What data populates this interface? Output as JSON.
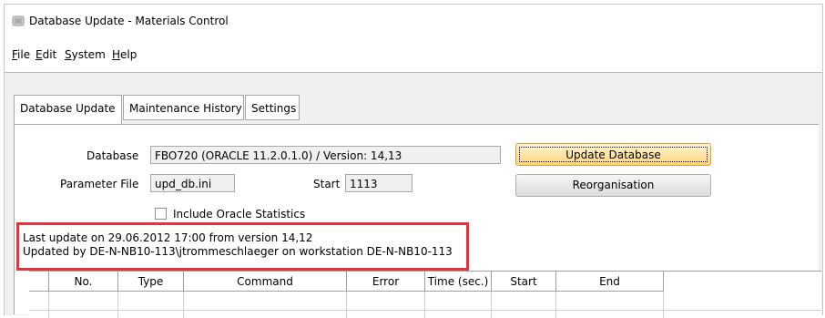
{
  "window": {
    "title": "Database Update - Materials Control"
  },
  "menu": [
    {
      "pre": "",
      "acc": "F",
      "post": "ile"
    },
    {
      "pre": "",
      "acc": "E",
      "post": "dit"
    },
    {
      "pre": "",
      "acc": "S",
      "post": "ystem"
    },
    {
      "pre": "",
      "acc": "H",
      "post": "elp"
    }
  ],
  "tabs": [
    "Database Update",
    "Maintenance History",
    "Settings"
  ],
  "form": {
    "database_label": "Database",
    "database_value": "FBO720 (ORACLE 11.2.0.1.0) / Version: 14,13",
    "parameter_label": "Parameter File",
    "parameter_value": "upd_db.ini",
    "start_label": "Start",
    "start_value": "1113",
    "include_stats_label": "Include Oracle Statistics",
    "include_stats_checked": false
  },
  "buttons": {
    "update": "Update Database",
    "reorg": "Reorganisation"
  },
  "info": {
    "line1": "Last update on 29.06.2012 17:00 from version 14,12",
    "line2": "Updated by DE-N-NB10-113\\jtrommeschlaeger on workstation DE-N-NB10-113"
  },
  "table": {
    "columns": [
      "No.",
      "Type",
      "Command",
      "Error",
      "Time (sec.)",
      "Start",
      "End"
    ]
  },
  "colors": {
    "highlight": "#e8323c",
    "primary_button": "#ffd57a"
  }
}
